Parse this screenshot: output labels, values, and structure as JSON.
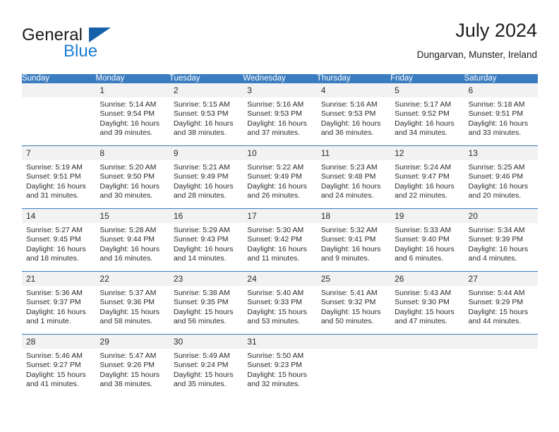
{
  "brand": {
    "name_part1": "General",
    "name_part2": "Blue",
    "triangle_color": "#1560a8",
    "blue_color": "#1c7fd1"
  },
  "header": {
    "title": "July 2024",
    "subtitle": "Dungarvan, Munster, Ireland"
  },
  "theme": {
    "header_bg": "#3a7cc0",
    "daynum_bg": "#f2f2f2",
    "text": "#2b2b2b"
  },
  "weekday_headers": [
    "Sunday",
    "Monday",
    "Tuesday",
    "Wednesday",
    "Thursday",
    "Friday",
    "Saturday"
  ],
  "weeks": [
    [
      {
        "day": "",
        "sunrise": "",
        "sunset": "",
        "daylight1": "",
        "daylight2": "",
        "empty": true
      },
      {
        "day": "1",
        "sunrise": "Sunrise: 5:14 AM",
        "sunset": "Sunset: 9:54 PM",
        "daylight1": "Daylight: 16 hours",
        "daylight2": "and 39 minutes.",
        "empty": false
      },
      {
        "day": "2",
        "sunrise": "Sunrise: 5:15 AM",
        "sunset": "Sunset: 9:53 PM",
        "daylight1": "Daylight: 16 hours",
        "daylight2": "and 38 minutes.",
        "empty": false
      },
      {
        "day": "3",
        "sunrise": "Sunrise: 5:16 AM",
        "sunset": "Sunset: 9:53 PM",
        "daylight1": "Daylight: 16 hours",
        "daylight2": "and 37 minutes.",
        "empty": false
      },
      {
        "day": "4",
        "sunrise": "Sunrise: 5:16 AM",
        "sunset": "Sunset: 9:53 PM",
        "daylight1": "Daylight: 16 hours",
        "daylight2": "and 36 minutes.",
        "empty": false
      },
      {
        "day": "5",
        "sunrise": "Sunrise: 5:17 AM",
        "sunset": "Sunset: 9:52 PM",
        "daylight1": "Daylight: 16 hours",
        "daylight2": "and 34 minutes.",
        "empty": false
      },
      {
        "day": "6",
        "sunrise": "Sunrise: 5:18 AM",
        "sunset": "Sunset: 9:51 PM",
        "daylight1": "Daylight: 16 hours",
        "daylight2": "and 33 minutes.",
        "empty": false
      }
    ],
    [
      {
        "day": "7",
        "sunrise": "Sunrise: 5:19 AM",
        "sunset": "Sunset: 9:51 PM",
        "daylight1": "Daylight: 16 hours",
        "daylight2": "and 31 minutes.",
        "empty": false
      },
      {
        "day": "8",
        "sunrise": "Sunrise: 5:20 AM",
        "sunset": "Sunset: 9:50 PM",
        "daylight1": "Daylight: 16 hours",
        "daylight2": "and 30 minutes.",
        "empty": false
      },
      {
        "day": "9",
        "sunrise": "Sunrise: 5:21 AM",
        "sunset": "Sunset: 9:49 PM",
        "daylight1": "Daylight: 16 hours",
        "daylight2": "and 28 minutes.",
        "empty": false
      },
      {
        "day": "10",
        "sunrise": "Sunrise: 5:22 AM",
        "sunset": "Sunset: 9:49 PM",
        "daylight1": "Daylight: 16 hours",
        "daylight2": "and 26 minutes.",
        "empty": false
      },
      {
        "day": "11",
        "sunrise": "Sunrise: 5:23 AM",
        "sunset": "Sunset: 9:48 PM",
        "daylight1": "Daylight: 16 hours",
        "daylight2": "and 24 minutes.",
        "empty": false
      },
      {
        "day": "12",
        "sunrise": "Sunrise: 5:24 AM",
        "sunset": "Sunset: 9:47 PM",
        "daylight1": "Daylight: 16 hours",
        "daylight2": "and 22 minutes.",
        "empty": false
      },
      {
        "day": "13",
        "sunrise": "Sunrise: 5:25 AM",
        "sunset": "Sunset: 9:46 PM",
        "daylight1": "Daylight: 16 hours",
        "daylight2": "and 20 minutes.",
        "empty": false
      }
    ],
    [
      {
        "day": "14",
        "sunrise": "Sunrise: 5:27 AM",
        "sunset": "Sunset: 9:45 PM",
        "daylight1": "Daylight: 16 hours",
        "daylight2": "and 18 minutes.",
        "empty": false
      },
      {
        "day": "15",
        "sunrise": "Sunrise: 5:28 AM",
        "sunset": "Sunset: 9:44 PM",
        "daylight1": "Daylight: 16 hours",
        "daylight2": "and 16 minutes.",
        "empty": false
      },
      {
        "day": "16",
        "sunrise": "Sunrise: 5:29 AM",
        "sunset": "Sunset: 9:43 PM",
        "daylight1": "Daylight: 16 hours",
        "daylight2": "and 14 minutes.",
        "empty": false
      },
      {
        "day": "17",
        "sunrise": "Sunrise: 5:30 AM",
        "sunset": "Sunset: 9:42 PM",
        "daylight1": "Daylight: 16 hours",
        "daylight2": "and 11 minutes.",
        "empty": false
      },
      {
        "day": "18",
        "sunrise": "Sunrise: 5:32 AM",
        "sunset": "Sunset: 9:41 PM",
        "daylight1": "Daylight: 16 hours",
        "daylight2": "and 9 minutes.",
        "empty": false
      },
      {
        "day": "19",
        "sunrise": "Sunrise: 5:33 AM",
        "sunset": "Sunset: 9:40 PM",
        "daylight1": "Daylight: 16 hours",
        "daylight2": "and 6 minutes.",
        "empty": false
      },
      {
        "day": "20",
        "sunrise": "Sunrise: 5:34 AM",
        "sunset": "Sunset: 9:39 PM",
        "daylight1": "Daylight: 16 hours",
        "daylight2": "and 4 minutes.",
        "empty": false
      }
    ],
    [
      {
        "day": "21",
        "sunrise": "Sunrise: 5:36 AM",
        "sunset": "Sunset: 9:37 PM",
        "daylight1": "Daylight: 16 hours",
        "daylight2": "and 1 minute.",
        "empty": false
      },
      {
        "day": "22",
        "sunrise": "Sunrise: 5:37 AM",
        "sunset": "Sunset: 9:36 PM",
        "daylight1": "Daylight: 15 hours",
        "daylight2": "and 58 minutes.",
        "empty": false
      },
      {
        "day": "23",
        "sunrise": "Sunrise: 5:38 AM",
        "sunset": "Sunset: 9:35 PM",
        "daylight1": "Daylight: 15 hours",
        "daylight2": "and 56 minutes.",
        "empty": false
      },
      {
        "day": "24",
        "sunrise": "Sunrise: 5:40 AM",
        "sunset": "Sunset: 9:33 PM",
        "daylight1": "Daylight: 15 hours",
        "daylight2": "and 53 minutes.",
        "empty": false
      },
      {
        "day": "25",
        "sunrise": "Sunrise: 5:41 AM",
        "sunset": "Sunset: 9:32 PM",
        "daylight1": "Daylight: 15 hours",
        "daylight2": "and 50 minutes.",
        "empty": false
      },
      {
        "day": "26",
        "sunrise": "Sunrise: 5:43 AM",
        "sunset": "Sunset: 9:30 PM",
        "daylight1": "Daylight: 15 hours",
        "daylight2": "and 47 minutes.",
        "empty": false
      },
      {
        "day": "27",
        "sunrise": "Sunrise: 5:44 AM",
        "sunset": "Sunset: 9:29 PM",
        "daylight1": "Daylight: 15 hours",
        "daylight2": "and 44 minutes.",
        "empty": false
      }
    ],
    [
      {
        "day": "28",
        "sunrise": "Sunrise: 5:46 AM",
        "sunset": "Sunset: 9:27 PM",
        "daylight1": "Daylight: 15 hours",
        "daylight2": "and 41 minutes.",
        "empty": false
      },
      {
        "day": "29",
        "sunrise": "Sunrise: 5:47 AM",
        "sunset": "Sunset: 9:26 PM",
        "daylight1": "Daylight: 15 hours",
        "daylight2": "and 38 minutes.",
        "empty": false
      },
      {
        "day": "30",
        "sunrise": "Sunrise: 5:49 AM",
        "sunset": "Sunset: 9:24 PM",
        "daylight1": "Daylight: 15 hours",
        "daylight2": "and 35 minutes.",
        "empty": false
      },
      {
        "day": "31",
        "sunrise": "Sunrise: 5:50 AM",
        "sunset": "Sunset: 9:23 PM",
        "daylight1": "Daylight: 15 hours",
        "daylight2": "and 32 minutes.",
        "empty": false
      },
      {
        "day": "",
        "sunrise": "",
        "sunset": "",
        "daylight1": "",
        "daylight2": "",
        "empty": true
      },
      {
        "day": "",
        "sunrise": "",
        "sunset": "",
        "daylight1": "",
        "daylight2": "",
        "empty": true
      },
      {
        "day": "",
        "sunrise": "",
        "sunset": "",
        "daylight1": "",
        "daylight2": "",
        "empty": true
      }
    ]
  ]
}
